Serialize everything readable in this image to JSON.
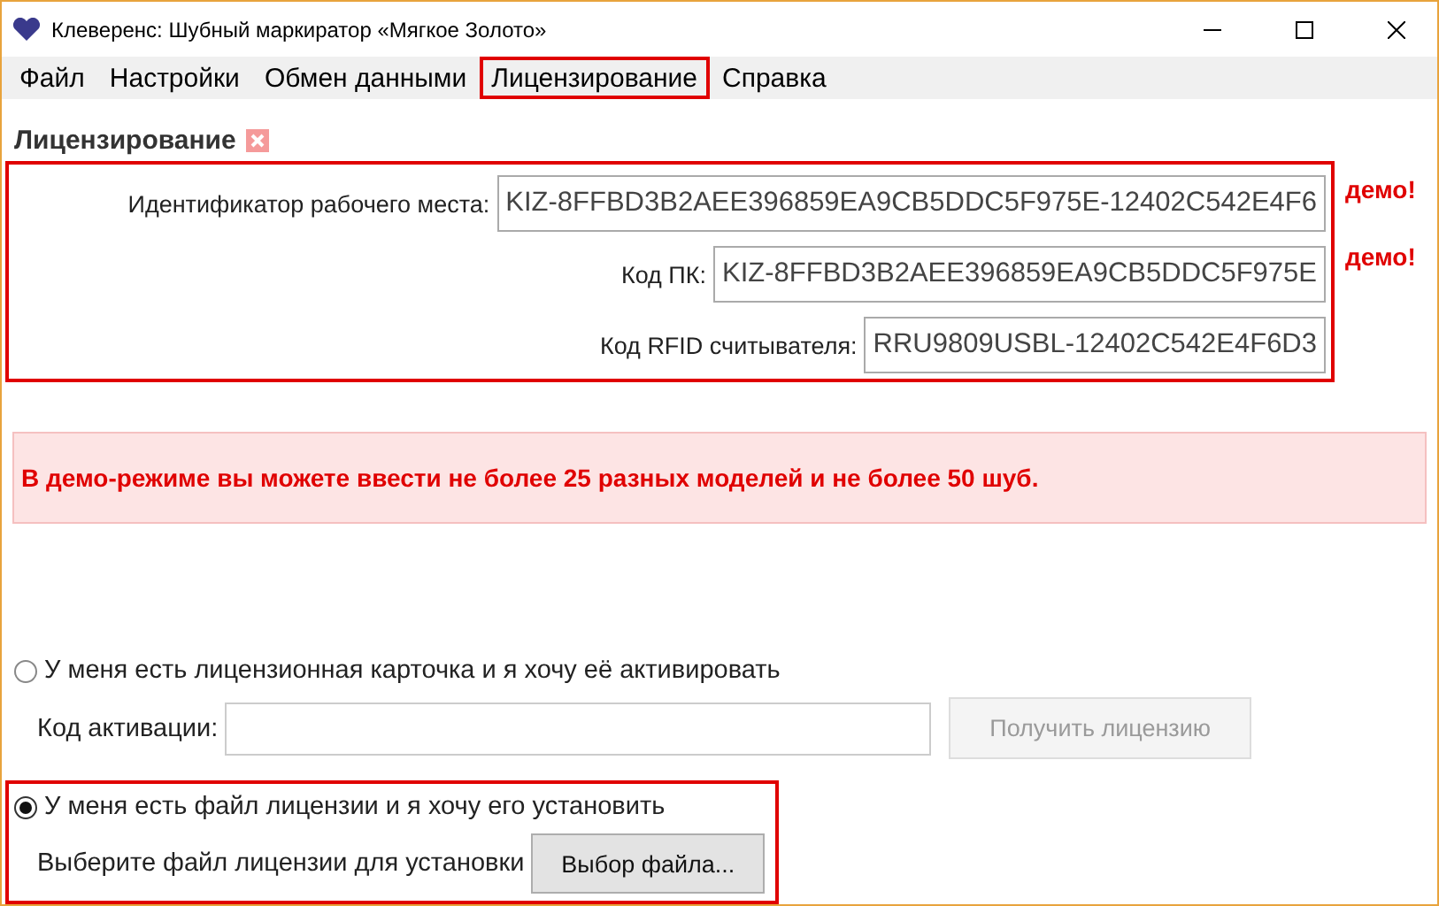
{
  "window": {
    "title": "Клеверенс: Шубный маркиратор «Мягкое Золото»"
  },
  "menu": [
    {
      "label": "Файл",
      "selected": false
    },
    {
      "label": "Настройки",
      "selected": false
    },
    {
      "label": "Обмен данными",
      "selected": false
    },
    {
      "label": "Лицензирование",
      "selected": true
    },
    {
      "label": "Справка",
      "selected": false
    }
  ],
  "section": {
    "title": "Лицензирование"
  },
  "ids": [
    {
      "label": "Идентификатор рабочего места:",
      "value": "KIZ-8FFBD3B2AEE396859EA9CB5DDC5F975E-12402C542E4F6",
      "note": "демо!"
    },
    {
      "label": "Код ПК:",
      "value": "KIZ-8FFBD3B2AEE396859EA9CB5DDC5F975E",
      "note": "демо!"
    },
    {
      "label": "Код RFID считывателя:",
      "value": "RRU9809USBL-12402C542E4F6D3"
    }
  ],
  "alert": "В демо-режиме вы можете ввести не более 25 разных моделей и не более 50 шуб.",
  "options": [
    {
      "label": "У меня есть лицензионная карточка и я хочу её активировать",
      "selected": false,
      "kind": "code",
      "field_label": "Код активации:",
      "button": "Получить лицензию",
      "button_disabled": true
    },
    {
      "label": "У меня есть файл лицензии и я хочу его установить",
      "selected": true,
      "kind": "file",
      "field_label": "Выберите файл лицензии для установки",
      "button": "Выбор файла...",
      "button_disabled": false
    }
  ]
}
